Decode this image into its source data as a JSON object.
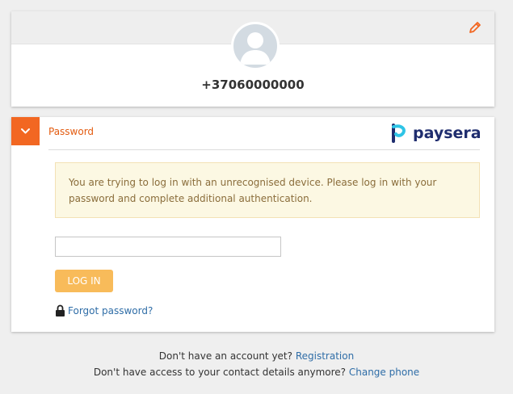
{
  "profile": {
    "phone": "+37060000000",
    "edit_icon": "pencil-icon",
    "avatar_icon": "user-icon"
  },
  "login": {
    "section_title": "Password",
    "brand": "paysera",
    "notice": "You are trying to log in with an unrecognised device. Please log in with your password and complete additional authentication.",
    "password_value": "",
    "button_label": "LOG IN",
    "forgot_label": "Forgot password?",
    "lock_icon": "lock-icon",
    "collapse_icon": "chevron-down-icon"
  },
  "footer": {
    "no_account_text": "Don't have an account yet?",
    "registration_link": "Registration",
    "no_access_text": "Don't have access to your contact details anymore?",
    "change_phone_link": "Change phone"
  },
  "colors": {
    "accent": "#f26722",
    "button": "#f8bb5a",
    "link": "#2f6da7",
    "brand_blue": "#1f2d6e",
    "notice_bg": "#fcf8e3"
  }
}
